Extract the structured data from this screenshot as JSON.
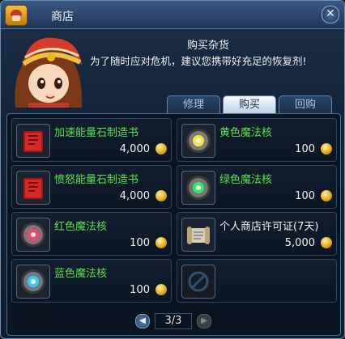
{
  "window": {
    "title": "商店",
    "close_label": "✕"
  },
  "greeting": {
    "title": "购买杂货",
    "text": "为了随时应对危机，建议您携带好充足的恢复剂!"
  },
  "tabs": [
    {
      "label": "修理",
      "active": false
    },
    {
      "label": "购买",
      "active": true
    },
    {
      "label": "回购",
      "active": false
    }
  ],
  "items": [
    {
      "name": "加速能量石制造书",
      "price": "4,000",
      "icon": "red-book-icon"
    },
    {
      "name": "黄色魔法核",
      "price": "100",
      "icon": "yellow-magic-core-icon"
    },
    {
      "name": "愤怒能量石制造书",
      "price": "4,000",
      "icon": "red-book-icon"
    },
    {
      "name": "绿色魔法核",
      "price": "100",
      "icon": "green-magic-core-icon"
    },
    {
      "name": "红色魔法核",
      "price": "100",
      "icon": "red-magic-core-icon"
    },
    {
      "name": "个人商店许可证(7天)",
      "price": "5,000",
      "icon": "scroll-license-icon"
    },
    {
      "name": "蓝色魔法核",
      "price": "100",
      "icon": "blue-magic-core-icon"
    }
  ],
  "pager": {
    "current": "3/3"
  },
  "colors": {
    "item_name": "#58e050",
    "accent": "#5f84ad"
  }
}
